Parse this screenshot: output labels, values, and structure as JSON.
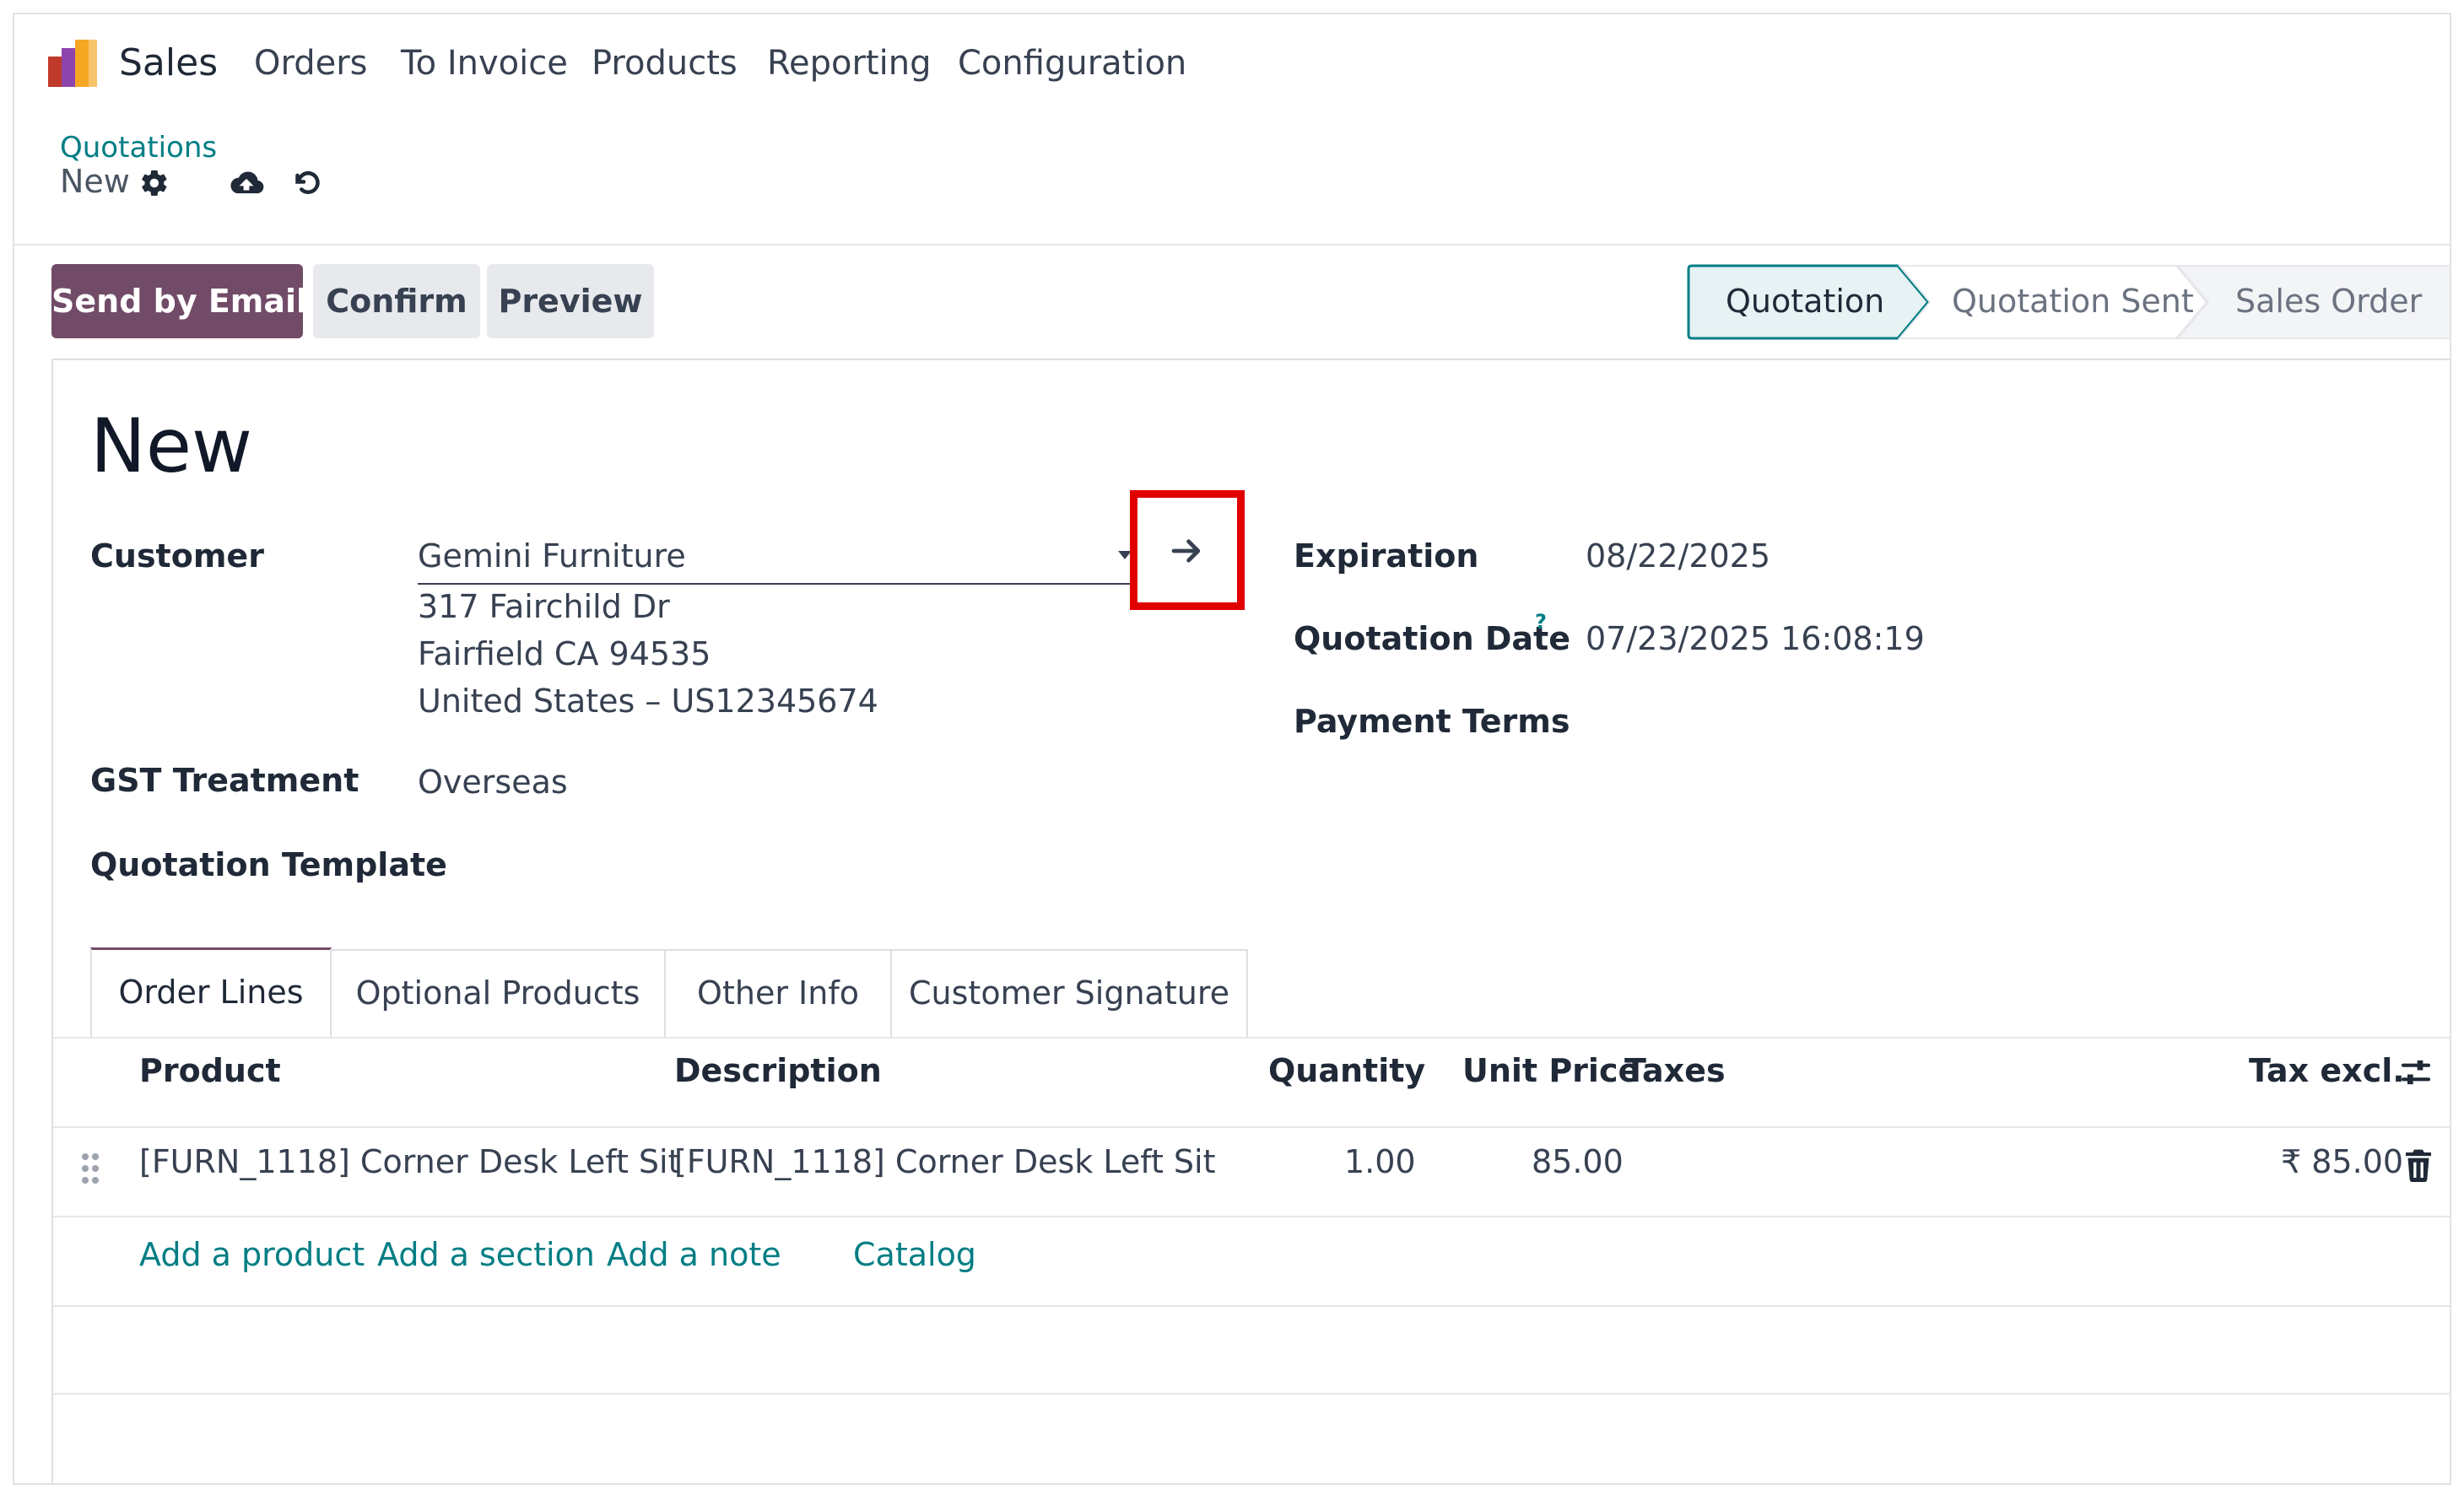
{
  "nav": {
    "app": "Sales",
    "items": [
      "Orders",
      "To Invoice",
      "Products",
      "Reporting",
      "Configuration"
    ]
  },
  "breadcrumb": {
    "parent": "Quotations",
    "current": "New"
  },
  "actions": {
    "send_email": "Send by Email",
    "confirm": "Confirm",
    "preview": "Preview"
  },
  "status": {
    "stages": [
      "Quotation",
      "Quotation Sent",
      "Sales Order"
    ],
    "active": "Quotation"
  },
  "form": {
    "title": "New",
    "customer_label": "Customer",
    "customer_value": "Gemini Furniture",
    "address_line1": "317 Fairchild Dr",
    "address_line2": "Fairfield CA 94535",
    "address_line3": "United States – US12345674",
    "gst_label": "GST Treatment",
    "gst_value": "Overseas",
    "template_label": "Quotation Template",
    "expiration_label": "Expiration",
    "expiration_value": "08/22/2025",
    "quotation_date_label": "Quotation Date",
    "quotation_date_help": "?",
    "quotation_date_value": "07/23/2025 16:08:19",
    "payment_terms_label": "Payment Terms"
  },
  "tabs": [
    "Order Lines",
    "Optional Products",
    "Other Info",
    "Customer Signature"
  ],
  "table": {
    "headers": {
      "product": "Product",
      "description": "Description",
      "quantity": "Quantity",
      "unit_price": "Unit Price",
      "taxes": "Taxes",
      "tax_excl": "Tax excl."
    },
    "rows": [
      {
        "product": "[FURN_1118] Corner Desk Left Sit",
        "description": "[FURN_1118] Corner Desk Left Sit",
        "quantity": "1.00",
        "unit_price": "85.00",
        "subtotal": "₹ 85.00"
      }
    ]
  },
  "line_actions": {
    "add_product": "Add a product",
    "add_section": "Add a section",
    "add_note": "Add a note",
    "catalog": "Catalog"
  },
  "colors": {
    "primary": "#714b67",
    "link": "#017e84",
    "highlight": "#e00000",
    "status_active_bg": "#e6f2f3"
  },
  "icons": {
    "settings": "gear-icon",
    "save": "cloud-upload-icon",
    "discard": "undo-icon",
    "open_record": "arrow-right-icon",
    "drag": "drag-handle-icon",
    "delete": "trash-icon",
    "optional_columns": "sliders-icon"
  }
}
